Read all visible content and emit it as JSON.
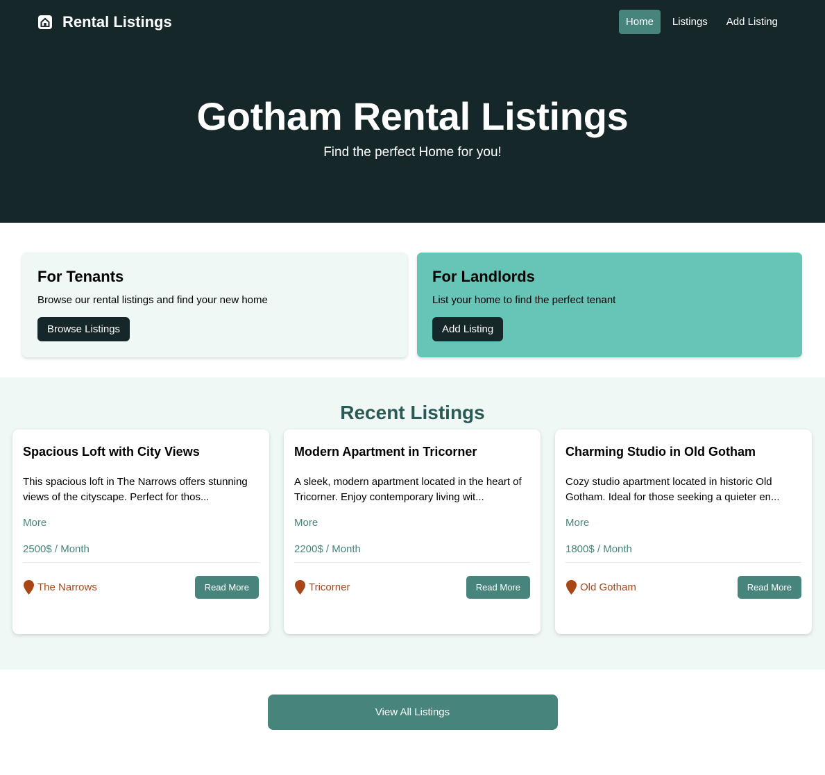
{
  "header": {
    "brand_icon": "house-icon",
    "brand_title": "Rental Listings",
    "nav": [
      {
        "label": "Home",
        "active": true
      },
      {
        "label": "Listings",
        "active": false
      },
      {
        "label": "Add Listing",
        "active": false
      }
    ]
  },
  "hero": {
    "title": "Gotham Rental Listings",
    "subtitle": "Find the perfect Home for you!"
  },
  "cta": {
    "tenants": {
      "title": "For Tenants",
      "text": "Browse our rental listings and find your new home",
      "button": "Browse Listings"
    },
    "landlords": {
      "title": "For Landlords",
      "text": "List your home to find the perfect tenant",
      "button": "Add Listing"
    }
  },
  "recent": {
    "title": "Recent Listings",
    "listings": [
      {
        "title": "Spacious Loft with City Views",
        "description": "This spacious loft in The Narrows offers stunning views of the cityscape. Perfect for thos...",
        "more": "More",
        "price": "2500$ / Month",
        "location": "The Narrows",
        "button": "Read More"
      },
      {
        "title": "Modern Apartment in Tricorner",
        "description": "A sleek, modern apartment located in the heart of Tricorner. Enjoy contemporary living wit...",
        "more": "More",
        "price": "2200$ / Month",
        "location": "Tricorner",
        "button": "Read More"
      },
      {
        "title": "Charming Studio in Old Gotham",
        "description": "Cozy studio apartment located in historic Old Gotham. Ideal for those seeking a quieter en...",
        "more": "More",
        "price": "1800$ / Month",
        "location": "Old Gotham",
        "button": "Read More"
      }
    ]
  },
  "view_all": "View All Listings",
  "colors": {
    "header_bg": "#16272a",
    "accent": "#47857c",
    "landlord_bg": "#66c5b7",
    "section_bg": "#eff8f5",
    "location": "#a84617"
  }
}
